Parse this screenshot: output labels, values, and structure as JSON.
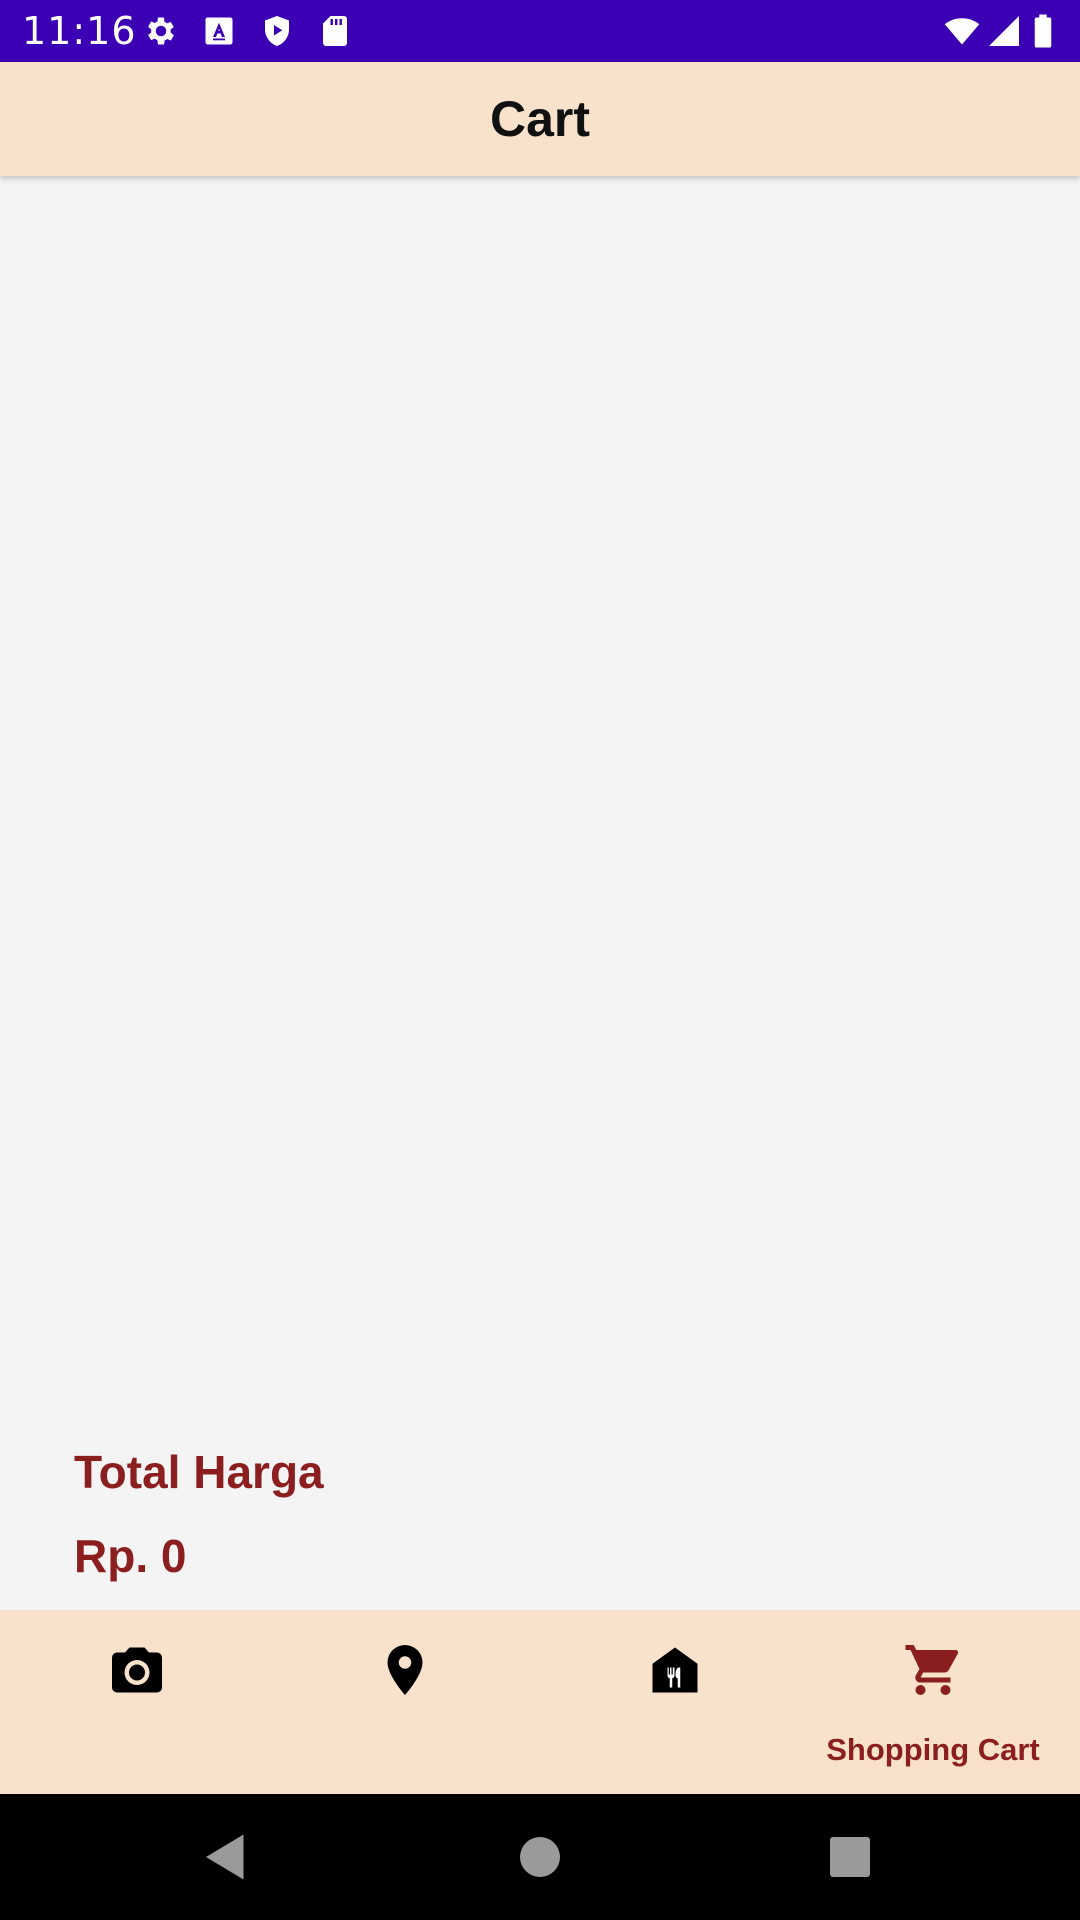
{
  "status_bar": {
    "time": "11:16",
    "icons": [
      "gear-icon",
      "text-a-icon",
      "play-shield-icon",
      "sd-card-icon",
      "wifi-icon",
      "signal-icon",
      "battery-icon"
    ]
  },
  "app_bar": {
    "title": "Cart"
  },
  "summary": {
    "total_label": "Total Harga",
    "total_value": "Rp. 0"
  },
  "bottom_nav": {
    "items": [
      {
        "icon": "camera-icon",
        "label": "",
        "selected": false
      },
      {
        "icon": "location-pin-icon",
        "label": "",
        "selected": false
      },
      {
        "icon": "restaurant-icon",
        "label": "",
        "selected": false
      },
      {
        "icon": "shopping-cart-icon",
        "label": "Shopping Cart",
        "selected": true
      }
    ]
  },
  "system_nav": {
    "buttons": [
      "back-icon",
      "home-icon",
      "recents-icon"
    ]
  },
  "colors": {
    "status_bar": "#3c00b4",
    "app_bar": "#f8e2cb",
    "accent": "#8b1f1f",
    "content_bg": "#f4f4f4"
  }
}
